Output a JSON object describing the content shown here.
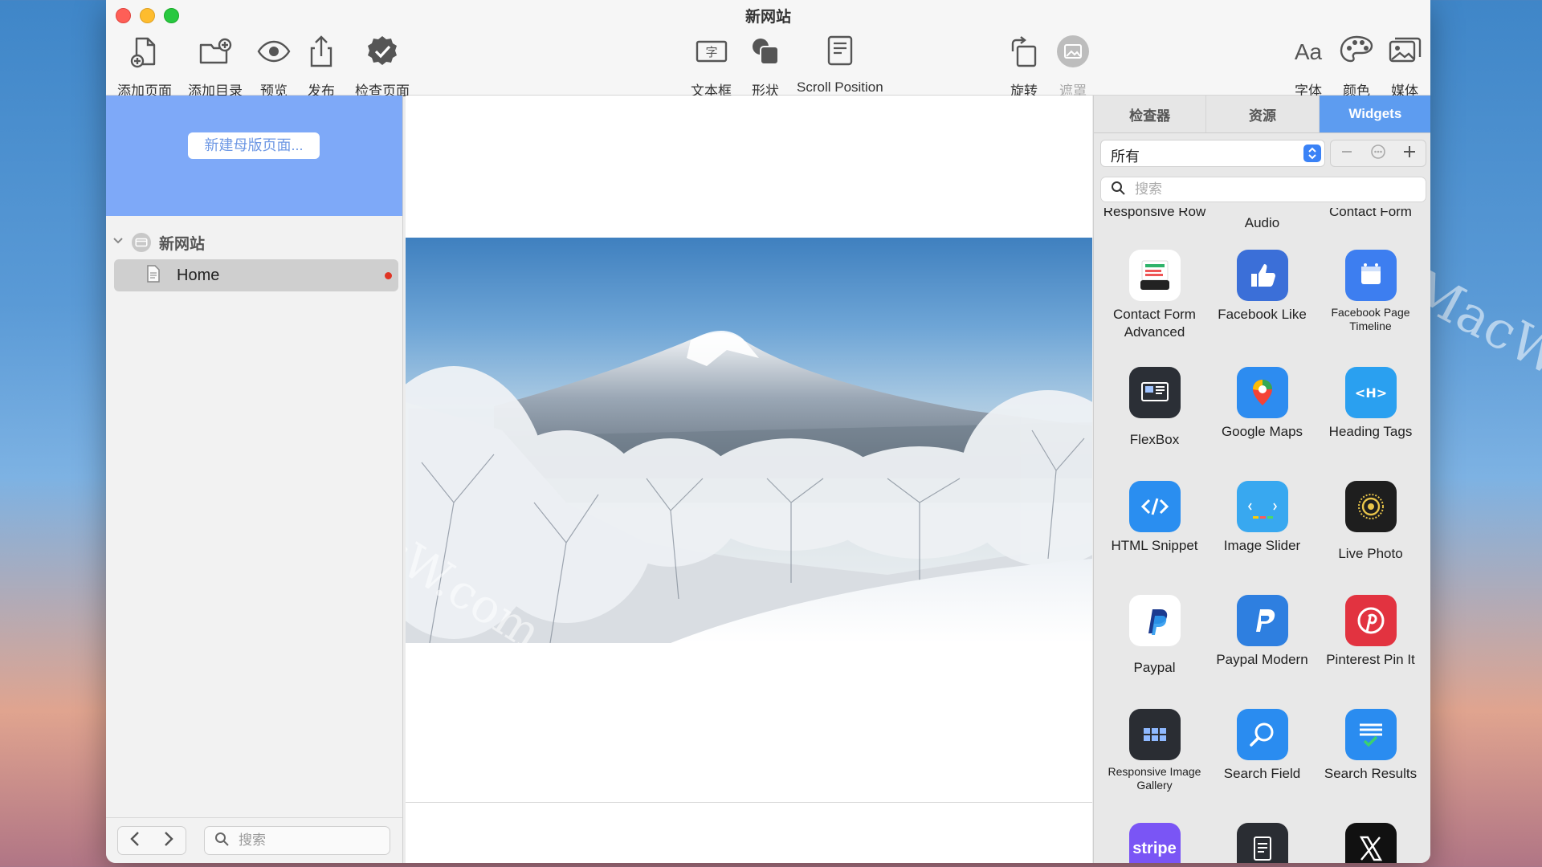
{
  "window": {
    "title": "新网站"
  },
  "toolbar": {
    "left": [
      {
        "id": "add-page",
        "label": "添加页面",
        "icon": "add-page-icon"
      },
      {
        "id": "add-folder",
        "label": "添加目录",
        "icon": "add-folder-icon"
      },
      {
        "id": "preview",
        "label": "预览",
        "icon": "eye-icon"
      },
      {
        "id": "publish",
        "label": "发布",
        "icon": "share-icon"
      },
      {
        "id": "check-page",
        "label": "检查页面",
        "icon": "check-badge-icon"
      }
    ],
    "center": [
      {
        "id": "textbox",
        "label": "文本框",
        "icon": "textbox-icon"
      },
      {
        "id": "shape",
        "label": "形状",
        "icon": "shape-icon"
      },
      {
        "id": "scroll-position",
        "label": "Scroll Position",
        "icon": "scroll-icon"
      },
      {
        "id": "rotate",
        "label": "旋转",
        "icon": "rotate-icon"
      },
      {
        "id": "mask",
        "label": "遮罩",
        "icon": "mask-icon",
        "disabled": true
      }
    ],
    "right": [
      {
        "id": "font",
        "label": "字体",
        "icon": "font-icon"
      },
      {
        "id": "color",
        "label": "颜色",
        "icon": "palette-icon"
      },
      {
        "id": "media",
        "label": "媒体",
        "icon": "media-icon"
      }
    ]
  },
  "sidebar": {
    "master_button": "新建母版页面...",
    "site": {
      "label": "新网站"
    },
    "pages": [
      {
        "label": "Home",
        "has_changes": true
      }
    ],
    "search": {
      "placeholder": "搜索"
    }
  },
  "panel": {
    "tabs": [
      {
        "label": "检查器",
        "active": false
      },
      {
        "label": "资源",
        "active": false
      },
      {
        "label": "Widgets",
        "active": true
      }
    ],
    "filter": {
      "value": "所有"
    },
    "search": {
      "placeholder": "搜索"
    },
    "top_row": [
      "Responsive Row",
      "Audio",
      "Contact Form"
    ],
    "widgets": [
      {
        "name": "Contact Form Advanced",
        "icon": "contact-form-advanced-icon",
        "bg": "#ffffff"
      },
      {
        "name": "Facebook Like",
        "icon": "thumbs-up-icon",
        "bg": "#3b6fd8"
      },
      {
        "name": "Facebook Page Timeline",
        "icon": "calendar-page-icon",
        "bg": "#3d7ef0",
        "small": true
      },
      {
        "name": "FlexBox",
        "icon": "flexbox-icon",
        "bg": "#2b2f36"
      },
      {
        "name": "Google Maps",
        "icon": "map-pin-icon",
        "bg": "#2d8cf0"
      },
      {
        "name": "Heading Tags",
        "icon": "heading-tag-icon",
        "bg": "#2aa0f0"
      },
      {
        "name": "HTML Snippet",
        "icon": "code-icon",
        "bg": "#2a8ef0"
      },
      {
        "name": "Image Slider",
        "icon": "image-slider-icon",
        "bg": "#38a8f0"
      },
      {
        "name": "Live Photo",
        "icon": "live-photo-icon",
        "bg": "#1e1e1e"
      },
      {
        "name": "Paypal",
        "icon": "paypal-icon",
        "bg": "#ffffff"
      },
      {
        "name": "Paypal Modern",
        "icon": "paypal-modern-icon",
        "bg": "#2e7fe0"
      },
      {
        "name": "Pinterest Pin It",
        "icon": "pinterest-icon",
        "bg": "#e23340"
      },
      {
        "name": "Responsive Image Gallery",
        "icon": "image-gallery-icon",
        "bg": "#2a2d33",
        "small": true
      },
      {
        "name": "Search Field",
        "icon": "search-field-icon",
        "bg": "#2a8cf0"
      },
      {
        "name": "Search Results",
        "icon": "search-results-icon",
        "bg": "#2a8cf0"
      },
      {
        "name": "",
        "icon": "stripe-icon",
        "bg": "#7a55f5",
        "text": "stripe"
      },
      {
        "name": "",
        "icon": "document-widget-icon",
        "bg": "#2a2d33"
      },
      {
        "name": "",
        "icon": "x-logo-icon",
        "bg": "#111111"
      }
    ]
  },
  "watermarks": [
    "MacW.com",
    "MacW.com",
    "MacW.com"
  ],
  "colors": {
    "accent": "#5d9cf0",
    "master_area": "#7ea9f8",
    "unsaved_dot": "#e03424"
  }
}
